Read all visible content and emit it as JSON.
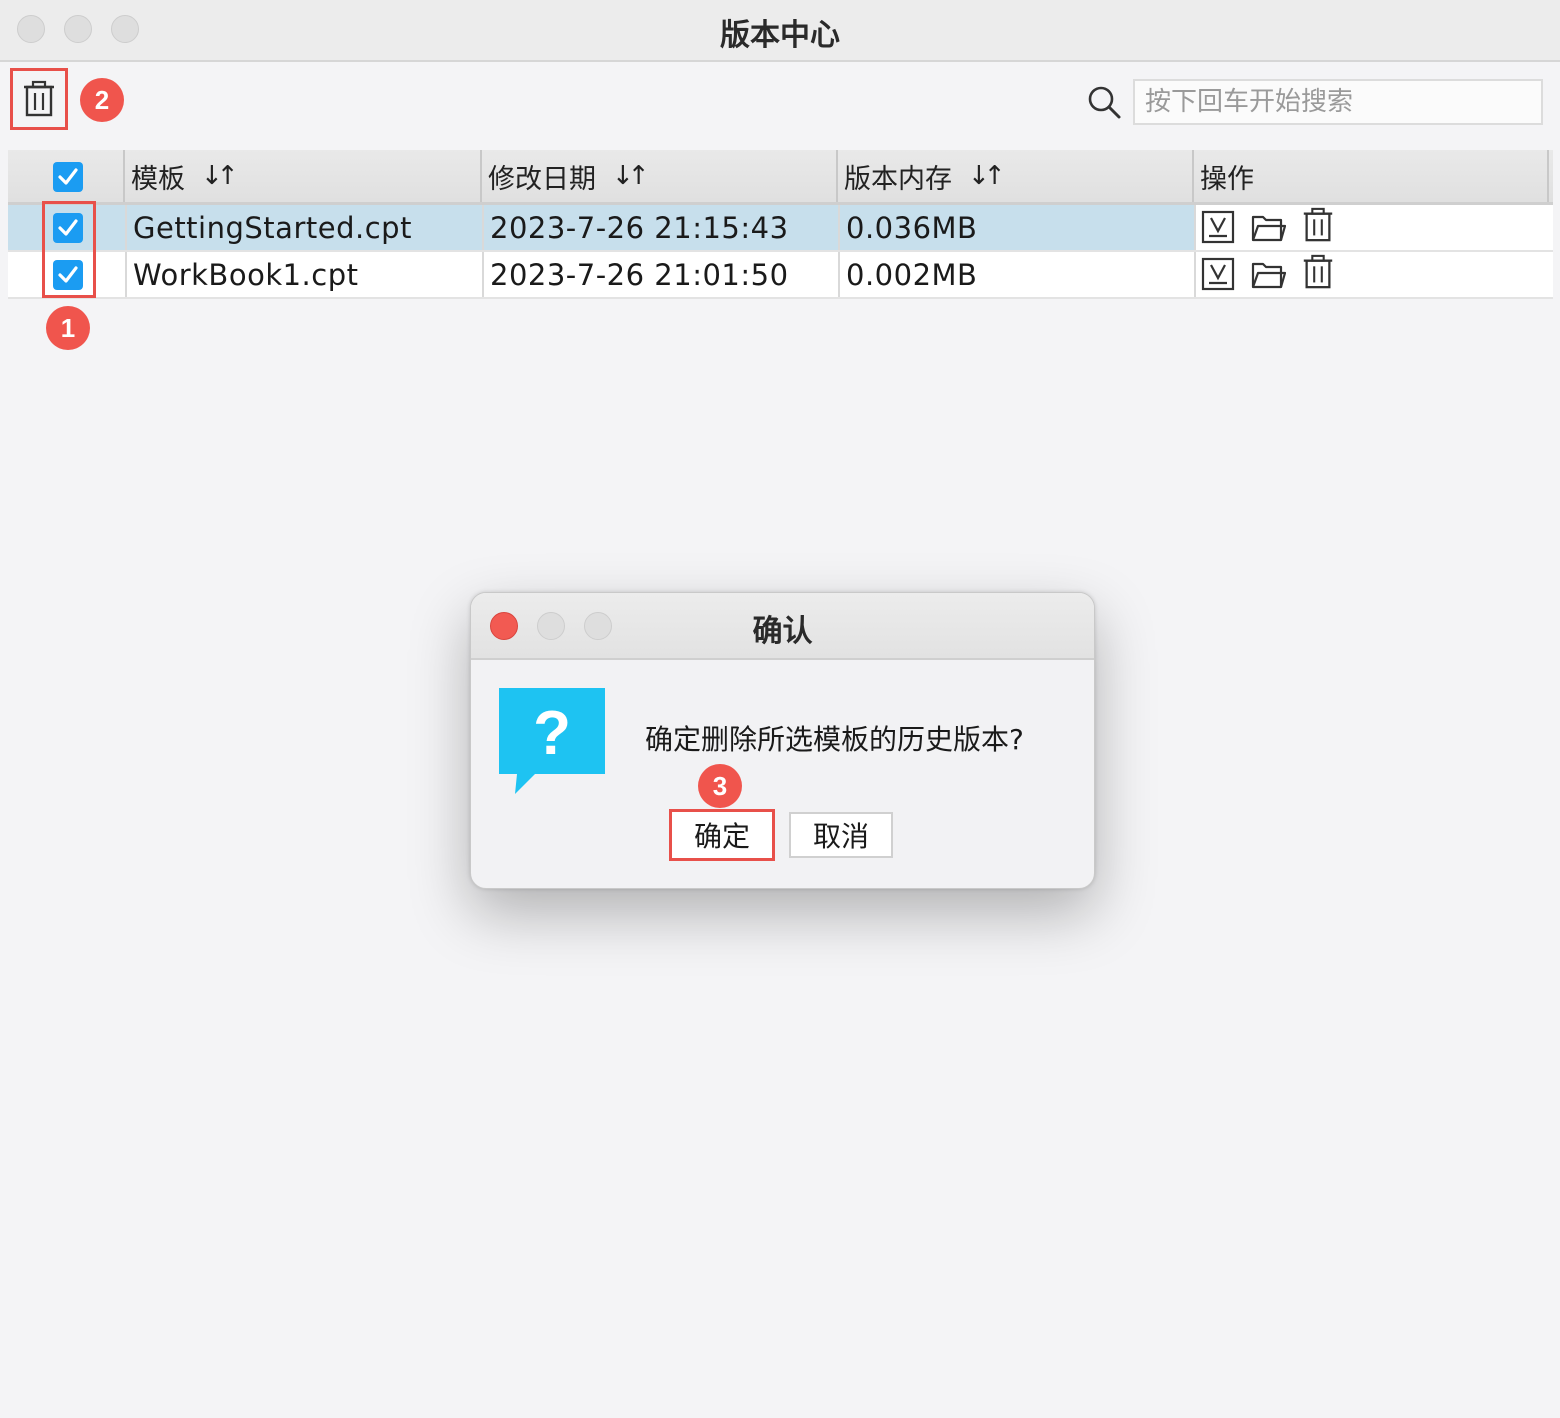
{
  "window": {
    "title": "版本中心"
  },
  "toolbar": {
    "search_placeholder": "按下回车开始搜索",
    "search_value": ""
  },
  "annotations": {
    "badge1": "1",
    "badge2": "2",
    "badge3": "3",
    "color": "#f0554d"
  },
  "table": {
    "columns": [
      {
        "label": "模板",
        "sortable": true
      },
      {
        "label": "修改日期",
        "sortable": true
      },
      {
        "label": "版本内存",
        "sortable": true
      },
      {
        "label": "操作",
        "sortable": false
      }
    ],
    "sort_glyph": "↓↑",
    "header_checked": true,
    "rows": [
      {
        "checked": true,
        "name": "GettingStarted.cpt",
        "date": "2023-7-26 21:15:43",
        "size": "0.036MB",
        "selected": true
      },
      {
        "checked": true,
        "name": "WorkBook1.cpt",
        "date": "2023-7-26 21:01:50",
        "size": "0.002MB",
        "selected": false
      }
    ],
    "row_actions": [
      "download-icon",
      "folder-icon",
      "trash-icon"
    ]
  },
  "dialog": {
    "title": "确认",
    "message": "确定删除所选模板的历史版本?",
    "icon": "question-icon",
    "icon_color": "#1ec3f2",
    "confirm_label": "确定",
    "cancel_label": "取消"
  },
  "colors": {
    "checkbox": "#1b9cf2",
    "selected_row": "#c7dfec",
    "highlight": "#e8504a"
  }
}
